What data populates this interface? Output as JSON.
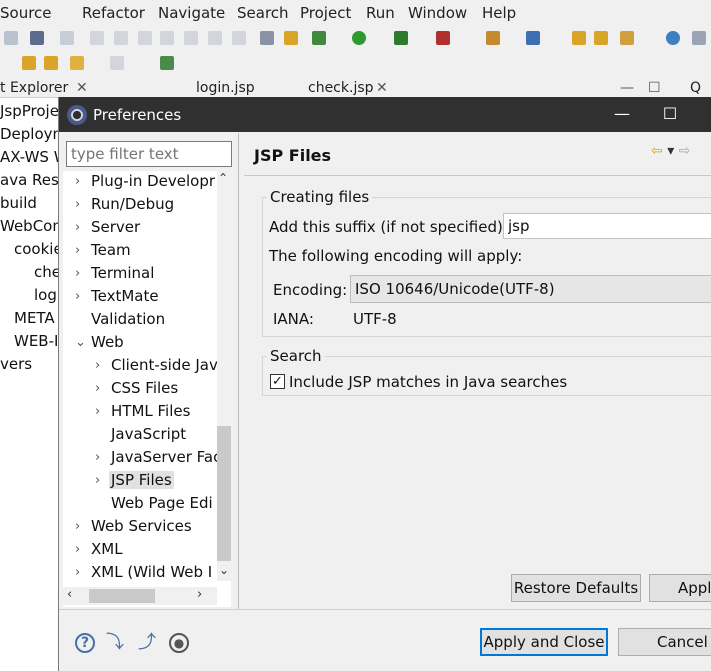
{
  "menubar": [
    "Source",
    "Refactor",
    "Navigate",
    "Search",
    "Project",
    "Run",
    "Window",
    "Help"
  ],
  "workbench": {
    "view_tab": "t Explorer",
    "editor_tabs": [
      "login.jsp",
      "check.jsp"
    ],
    "right_tab": "Q",
    "project_tree": [
      "JspProje",
      "Deploym",
      "AX-WS W",
      "ava Reso",
      "build",
      "WebCon",
      "cookie",
      "che",
      "log",
      "META",
      "WEB-I",
      "vers"
    ]
  },
  "dialog": {
    "title": "Preferences",
    "filter_placeholder": "type filter text",
    "tree": [
      {
        "label": "Plug-in Developr",
        "level": 0,
        "twisty": ">"
      },
      {
        "label": "Run/Debug",
        "level": 0,
        "twisty": ">"
      },
      {
        "label": "Server",
        "level": 0,
        "twisty": ">"
      },
      {
        "label": "Team",
        "level": 0,
        "twisty": ">"
      },
      {
        "label": "Terminal",
        "level": 0,
        "twisty": ">"
      },
      {
        "label": "TextMate",
        "level": 0,
        "twisty": ">"
      },
      {
        "label": "Validation",
        "level": 0,
        "twisty": ""
      },
      {
        "label": "Web",
        "level": 0,
        "twisty": "v"
      },
      {
        "label": "Client-side Jav",
        "level": 1,
        "twisty": ">"
      },
      {
        "label": "CSS Files",
        "level": 1,
        "twisty": ">"
      },
      {
        "label": "HTML Files",
        "level": 1,
        "twisty": ">"
      },
      {
        "label": "JavaScript",
        "level": 1,
        "twisty": ""
      },
      {
        "label": "JavaServer Fac",
        "level": 1,
        "twisty": ">"
      },
      {
        "label": "JSP Files",
        "level": 1,
        "twisty": ">",
        "selected": true
      },
      {
        "label": "Web Page Edi",
        "level": 1,
        "twisty": ""
      },
      {
        "label": "Web Services",
        "level": 0,
        "twisty": ">"
      },
      {
        "label": "XML",
        "level": 0,
        "twisty": ">"
      },
      {
        "label": "XML (Wild Web I",
        "level": 0,
        "twisty": ">"
      }
    ],
    "page": {
      "title": "JSP Files",
      "creating_files_group": "Creating files",
      "suffix_label": "Add this suffix (if not specified):",
      "suffix_value": "jsp",
      "encoding_note": "The following encoding will apply:",
      "encoding_label": "Encoding:",
      "encoding_value": "ISO 10646/Unicode(UTF-8)",
      "iana_label": "IANA:",
      "iana_value": "UTF-8",
      "search_group": "Search",
      "include_jsp_label": "Include JSP matches in Java searches",
      "include_jsp_checked": true
    },
    "buttons": {
      "restore_defaults": "Restore Defaults",
      "apply": "Appl",
      "apply_and_close": "Apply and Close",
      "cancel": "Cancel"
    }
  }
}
